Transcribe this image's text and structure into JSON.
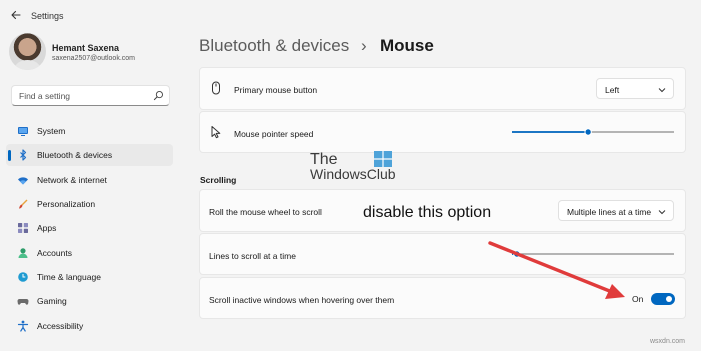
{
  "window": {
    "title": "Settings"
  },
  "user": {
    "name": "Hemant Saxena",
    "email": "saxena2507@outlook.com"
  },
  "search": {
    "placeholder": "Find a setting"
  },
  "sidebar": {
    "items": [
      {
        "label": "System",
        "icon": "monitor-icon",
        "active": false
      },
      {
        "label": "Bluetooth & devices",
        "icon": "bluetooth-icon",
        "active": true
      },
      {
        "label": "Network & internet",
        "icon": "wifi-icon",
        "active": false
      },
      {
        "label": "Personalization",
        "icon": "brush-icon",
        "active": false
      },
      {
        "label": "Apps",
        "icon": "apps-icon",
        "active": false
      },
      {
        "label": "Accounts",
        "icon": "person-icon",
        "active": false
      },
      {
        "label": "Time & language",
        "icon": "globe-clock-icon",
        "active": false
      },
      {
        "label": "Gaming",
        "icon": "controller-icon",
        "active": false
      },
      {
        "label": "Accessibility",
        "icon": "accessibility-icon",
        "active": false
      }
    ]
  },
  "header": {
    "parent": "Bluetooth & devices",
    "separator": "›",
    "current": "Mouse"
  },
  "settings": {
    "primary_button": {
      "label": "Primary mouse button",
      "value": "Left"
    },
    "pointer_speed": {
      "label": "Mouse pointer speed",
      "level": 0.47
    },
    "scrolling_header": "Scrolling",
    "roll_wheel": {
      "label": "Roll the mouse wheel to scroll",
      "value": "Multiple lines at a time"
    },
    "lines_to_scroll": {
      "label": "Lines to scroll at a time",
      "level": 0.03
    },
    "scroll_inactive": {
      "label": "Scroll inactive windows when hovering over them",
      "state": "On"
    }
  },
  "watermark": {
    "line1": "The",
    "line2": "WindowsClub",
    "site": "wsxdn.com"
  },
  "annotation": {
    "text": "disable this option"
  },
  "colors": {
    "accent": "#0067c0",
    "arrow": "#e03b3b",
    "background": "#f3f3f3",
    "card": "#fbfbfb"
  }
}
